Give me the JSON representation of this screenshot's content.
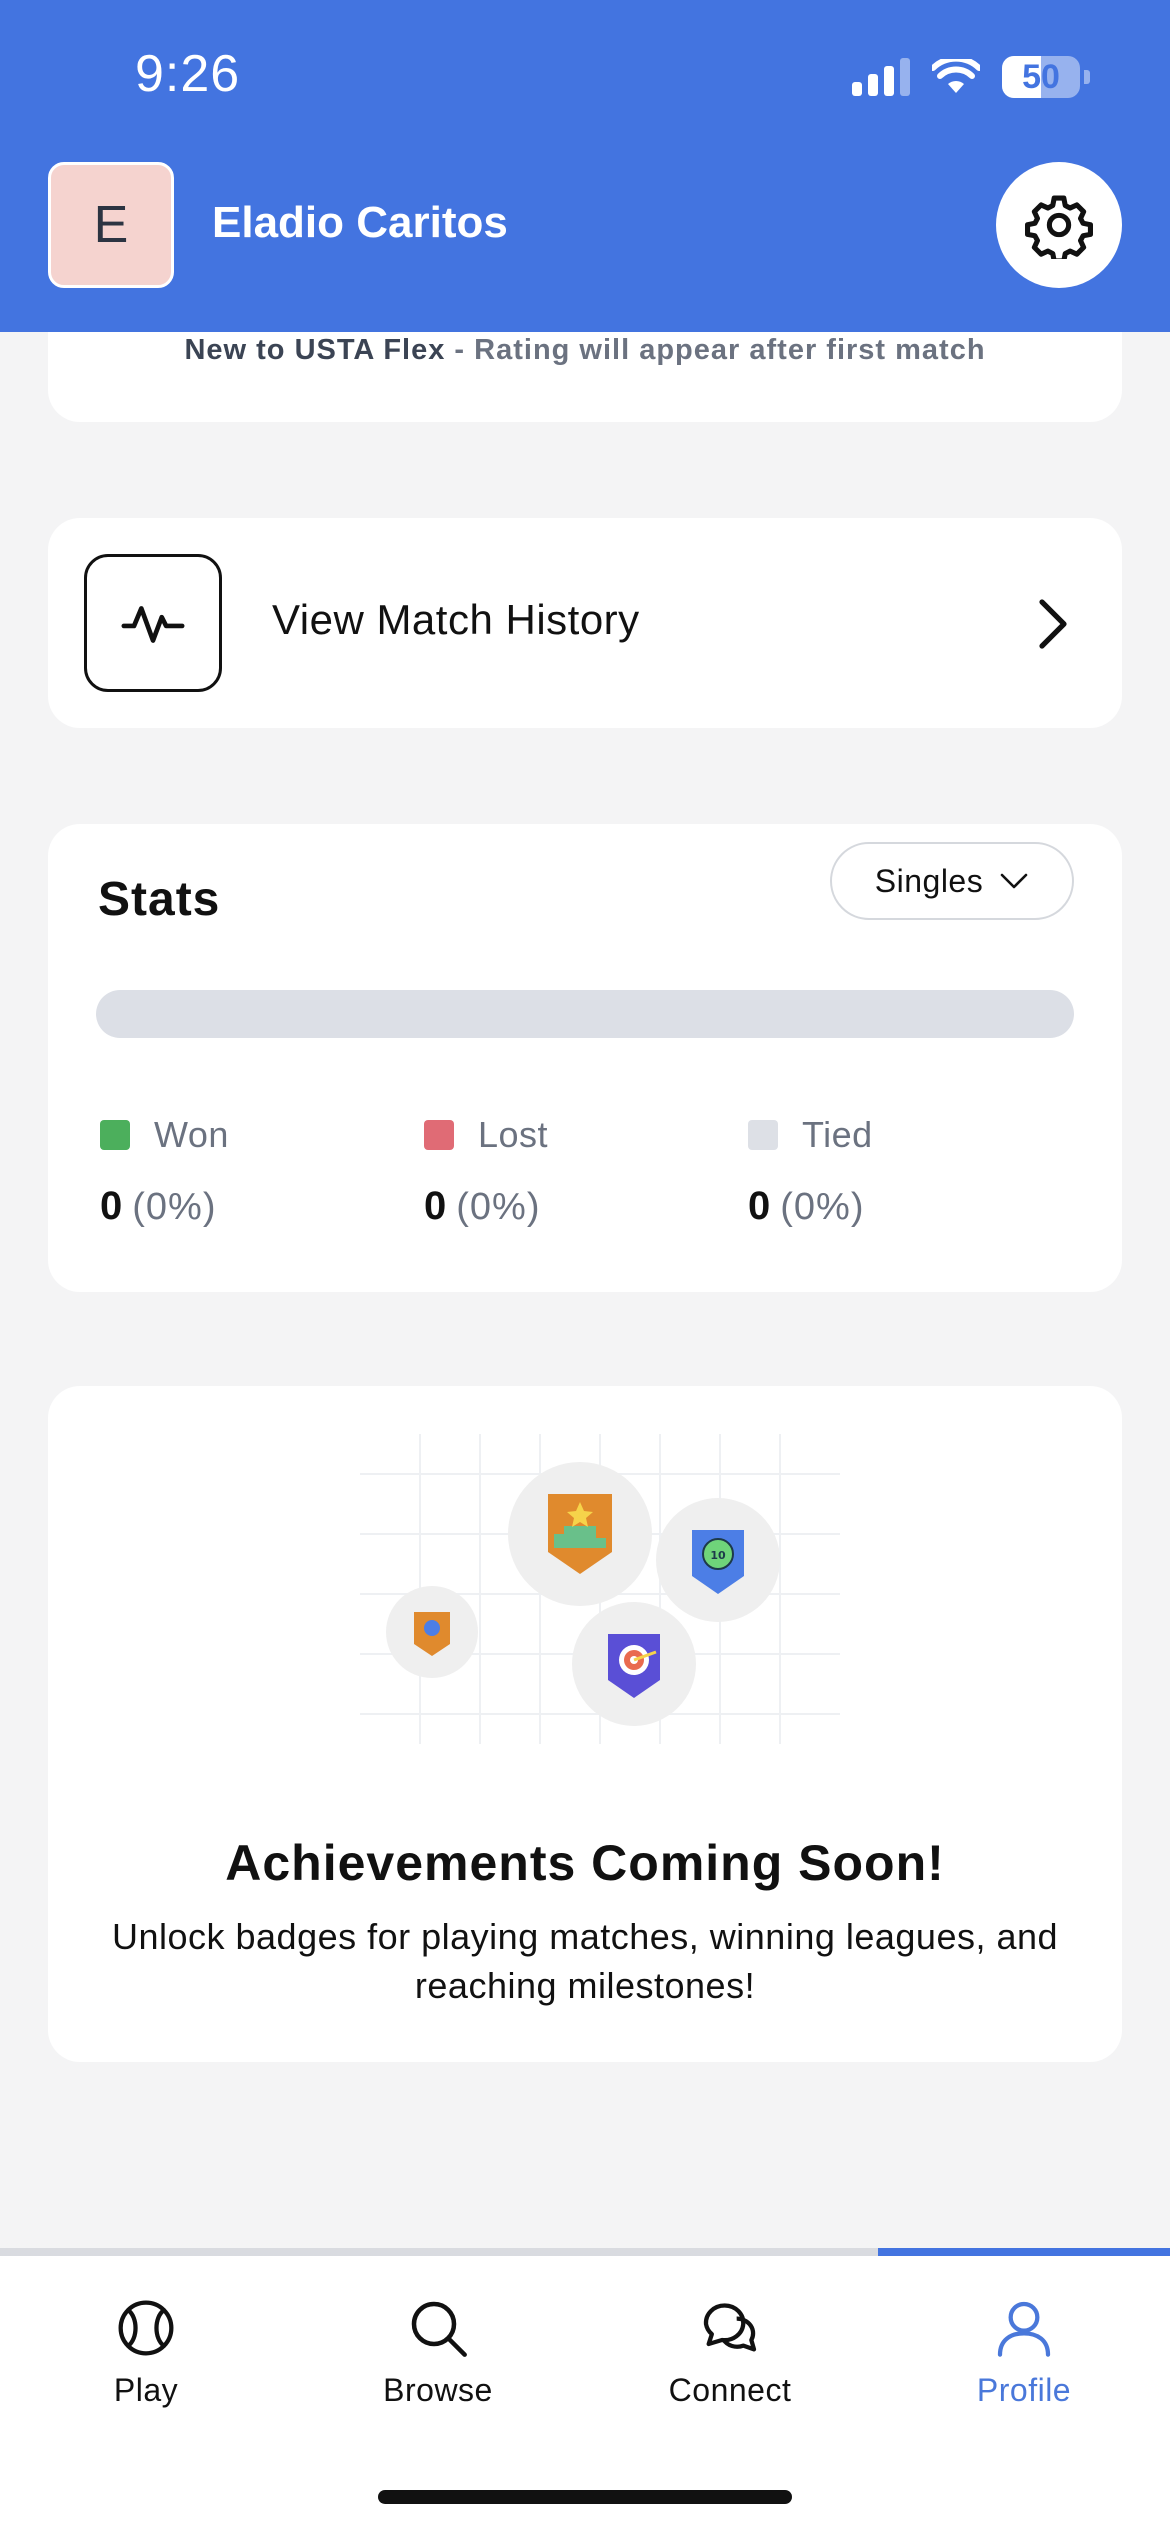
{
  "status_bar": {
    "time": "9:26",
    "battery": "50"
  },
  "header": {
    "avatar_initial": "E",
    "user_name": "Eladio Caritos"
  },
  "rating": {
    "prefix": "New to USTA Flex",
    "separator": " - ",
    "message": "Rating will appear after first match"
  },
  "match_history": {
    "label": "View Match History"
  },
  "stats": {
    "title": "Stats",
    "filter_selected": "Singles",
    "items": [
      {
        "label": "Won",
        "value": "0",
        "pct": "(0%)",
        "color": "#4caf5c"
      },
      {
        "label": "Lost",
        "value": "0",
        "pct": "(0%)",
        "color": "#e06b75"
      },
      {
        "label": "Tied",
        "value": "0",
        "pct": "(0%)",
        "color": "#dde0e6"
      }
    ]
  },
  "achievements": {
    "title": "Achievements Coming Soon!",
    "description": "Unlock badges for playing matches, winning leagues, and reaching milestones!"
  },
  "nav": {
    "tabs": [
      {
        "label": "Play",
        "icon": "tennis-ball-icon"
      },
      {
        "label": "Browse",
        "icon": "search-icon"
      },
      {
        "label": "Connect",
        "icon": "chat-bubbles-icon"
      },
      {
        "label": "Profile",
        "icon": "user-icon",
        "active": true
      }
    ]
  },
  "colors": {
    "brand": "#4374e0",
    "active_tab": "#4a78da"
  }
}
